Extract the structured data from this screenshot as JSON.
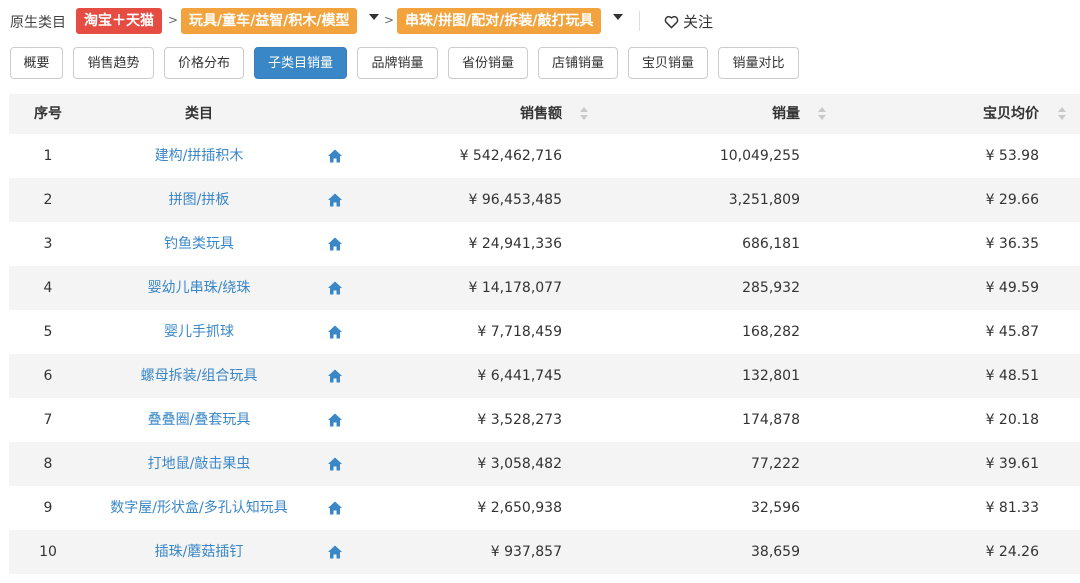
{
  "breadcrumb": {
    "label": "原生类目",
    "platform": "淘宝＋天猫",
    "level1": "玩具/童车/益智/积木/模型",
    "level2": "串珠/拼图/配对/拆装/敲打玩具",
    "sep": ">",
    "follow": "关注"
  },
  "tabs": [
    {
      "label": "概要"
    },
    {
      "label": "销售趋势"
    },
    {
      "label": "价格分布"
    },
    {
      "label": "子类目销量"
    },
    {
      "label": "品牌销量"
    },
    {
      "label": "省份销量"
    },
    {
      "label": "店铺销量"
    },
    {
      "label": "宝贝销量"
    },
    {
      "label": "销量对比"
    }
  ],
  "active_tab": "子类目销量",
  "table": {
    "headers": {
      "no": "序号",
      "category": "类目",
      "amount": "销售额",
      "qty": "销量",
      "avg": "宝贝均价"
    },
    "rows": [
      {
        "no": "1",
        "category": "建构/拼插积木",
        "amount": "¥ 542,462,716",
        "qty": "10,049,255",
        "avg": "¥ 53.98"
      },
      {
        "no": "2",
        "category": "拼图/拼板",
        "amount": "¥ 96,453,485",
        "qty": "3,251,809",
        "avg": "¥ 29.66"
      },
      {
        "no": "3",
        "category": "钓鱼类玩具",
        "amount": "¥ 24,941,336",
        "qty": "686,181",
        "avg": "¥ 36.35"
      },
      {
        "no": "4",
        "category": "婴幼儿串珠/绕珠",
        "amount": "¥ 14,178,077",
        "qty": "285,932",
        "avg": "¥ 49.59"
      },
      {
        "no": "5",
        "category": "婴儿手抓球",
        "amount": "¥ 7,718,459",
        "qty": "168,282",
        "avg": "¥ 45.87"
      },
      {
        "no": "6",
        "category": "螺母拆装/组合玩具",
        "amount": "¥ 6,441,745",
        "qty": "132,801",
        "avg": "¥ 48.51"
      },
      {
        "no": "7",
        "category": "叠叠圈/叠套玩具",
        "amount": "¥ 3,528,273",
        "qty": "174,878",
        "avg": "¥ 20.18"
      },
      {
        "no": "8",
        "category": "打地鼠/敲击果虫",
        "amount": "¥ 3,058,482",
        "qty": "77,222",
        "avg": "¥ 39.61"
      },
      {
        "no": "9",
        "category": "数字屋/形状盒/多孔认知玩具",
        "amount": "¥ 2,650,938",
        "qty": "32,596",
        "avg": "¥ 81.33"
      },
      {
        "no": "10",
        "category": "插珠/蘑菇插钉",
        "amount": "¥ 937,857",
        "qty": "38,659",
        "avg": "¥ 24.26"
      }
    ]
  },
  "colors": {
    "accent": "#3a87c8",
    "tag_red": "#e54d42",
    "tag_orange": "#f3a33d"
  },
  "icons": {
    "row_action": "home-icon",
    "follow": "heart-icon",
    "sort": "sort-icon"
  }
}
